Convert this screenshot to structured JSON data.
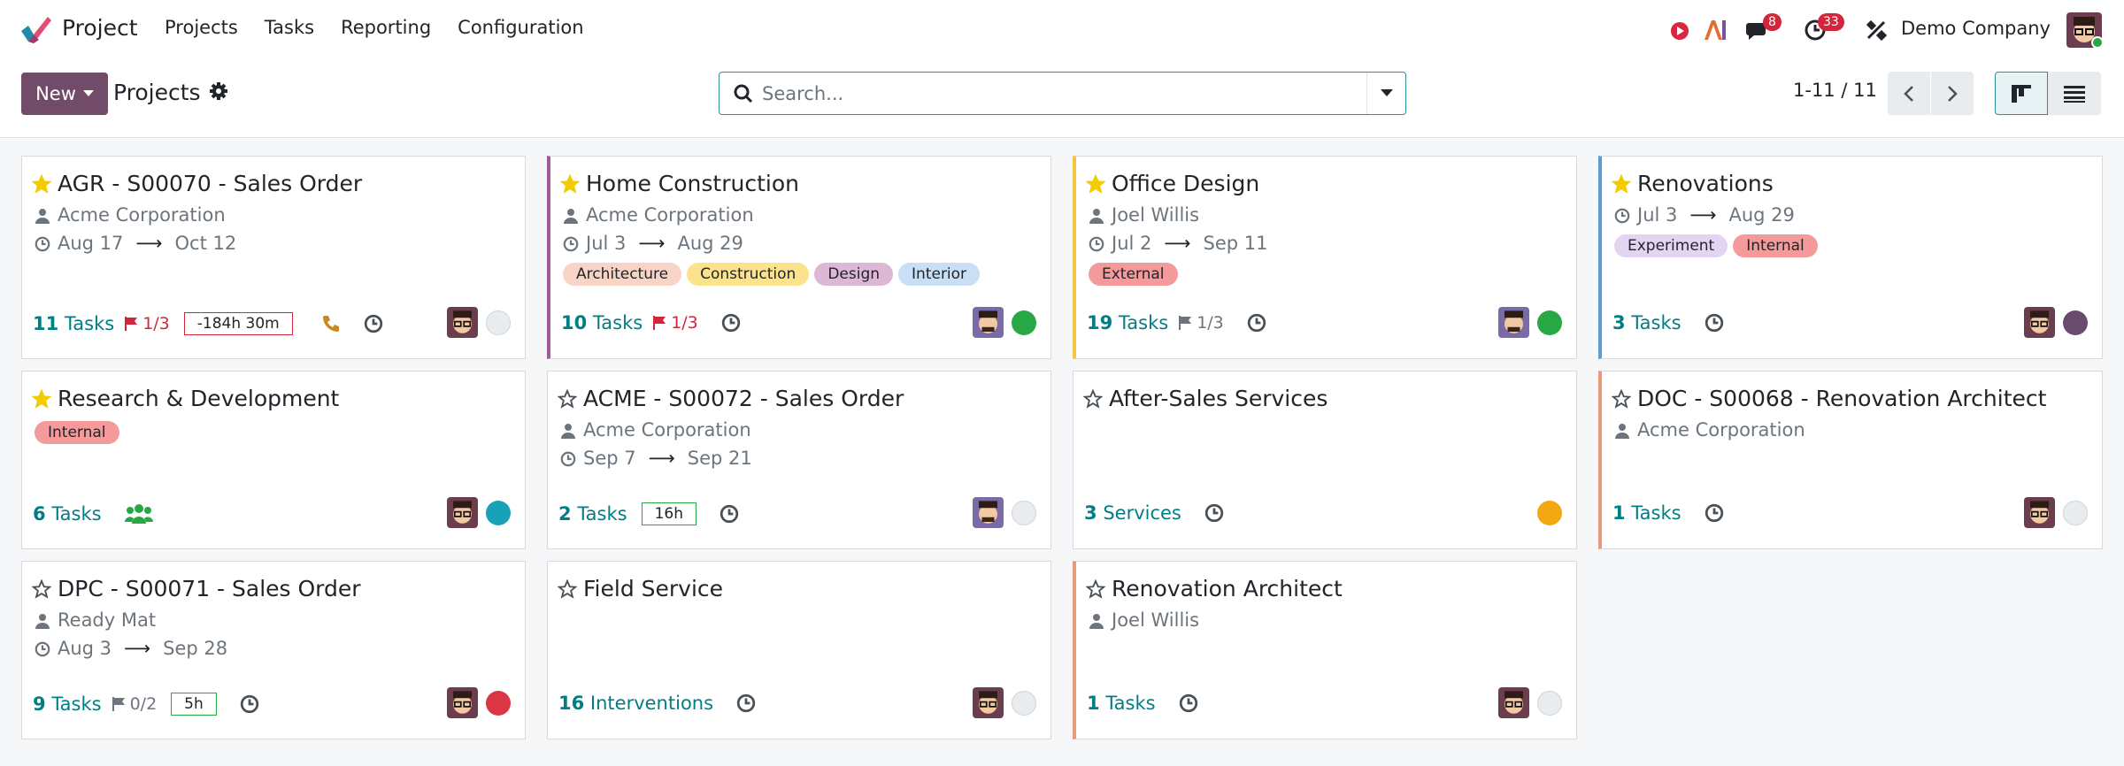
{
  "app": {
    "name": "Project"
  },
  "menu": [
    "Projects",
    "Tasks",
    "Reporting",
    "Configuration"
  ],
  "systray": {
    "messages_count": "8",
    "activities_count": "33",
    "company": "Demo Company"
  },
  "control": {
    "new_label": "New",
    "title": "Projects",
    "search_placeholder": "Search...",
    "pager": "1-11 / 11"
  },
  "colors": {
    "brand": "#714b67",
    "link": "#017e84",
    "star": "#f3cc00"
  },
  "cards": [
    {
      "title": "AGR - S00070 - Sales Order",
      "starred": true,
      "customer": "Acme Corporation",
      "date_start": "Aug 17",
      "date_end": "Oct 12",
      "tags": [],
      "count": "11",
      "count_label": "Tasks",
      "milestone": "1/3",
      "milestone_color": "red",
      "time": "-184h 30m",
      "time_color": "red",
      "extra_icon": "phone-icon",
      "status": "grey",
      "accent": ""
    },
    {
      "title": "Home Construction",
      "starred": true,
      "customer": "Acme Corporation",
      "date_start": "Jul 3",
      "date_end": "Aug 29",
      "tags": [
        "Architecture",
        "Construction",
        "Design",
        "Interior"
      ],
      "count": "10",
      "count_label": "Tasks",
      "milestone": "1/3",
      "milestone_color": "red",
      "status": "green",
      "accent": "#a05b9b"
    },
    {
      "title": "Office Design",
      "starred": true,
      "customer": "Joel Willis",
      "date_start": "Jul 2",
      "date_end": "Sep 11",
      "tags": [
        "External"
      ],
      "count": "19",
      "count_label": "Tasks",
      "milestone": "1/3",
      "milestone_color": "grey",
      "status": "green",
      "accent": "#f4c542"
    },
    {
      "title": "Renovations",
      "starred": true,
      "customer": "",
      "date_start": "Jul 3",
      "date_end": "Aug 29",
      "tags": [
        "Experiment",
        "Internal"
      ],
      "count": "3",
      "count_label": "Tasks",
      "status": "purple",
      "accent": "#5d9ad6"
    },
    {
      "title": "Research & Development",
      "starred": true,
      "tags": [
        "Internal"
      ],
      "count": "6",
      "count_label": "Tasks",
      "status": "teal",
      "accent": ""
    },
    {
      "title": "ACME - S00072 - Sales Order",
      "starred": false,
      "customer": "Acme Corporation",
      "date_start": "Sep 7",
      "date_end": "Sep 21",
      "tags": [],
      "count": "2",
      "count_label": "Tasks",
      "time": "16h",
      "time_color": "green",
      "status": "grey",
      "accent": ""
    },
    {
      "title": "After-Sales Services",
      "starred": false,
      "tags": [],
      "count": "3",
      "count_label": "Services",
      "status": "orange",
      "accent": ""
    },
    {
      "title": "DOC - S00068 - Renovation Architect",
      "starred": false,
      "customer": "Acme Corporation",
      "tags": [],
      "count": "1",
      "count_label": "Tasks",
      "status": "grey",
      "accent": "#e89a7a"
    },
    {
      "title": "DPC - S00071 - Sales Order",
      "starred": false,
      "customer": "Ready Mat",
      "date_start": "Aug 3",
      "date_end": "Sep 28",
      "tags": [],
      "count": "9",
      "count_label": "Tasks",
      "milestone": "0/2",
      "milestone_color": "grey",
      "time": "5h",
      "time_color": "green",
      "status": "red",
      "accent": ""
    },
    {
      "title": "Field Service",
      "starred": false,
      "tags": [],
      "count": "16",
      "count_label": "Interventions",
      "status": "grey",
      "accent": ""
    },
    {
      "title": "Renovation Architect",
      "starred": false,
      "customer": "Joel Willis",
      "tags": [],
      "count": "1",
      "count_label": "Tasks",
      "status": "grey",
      "accent": "#e89a7a"
    }
  ]
}
